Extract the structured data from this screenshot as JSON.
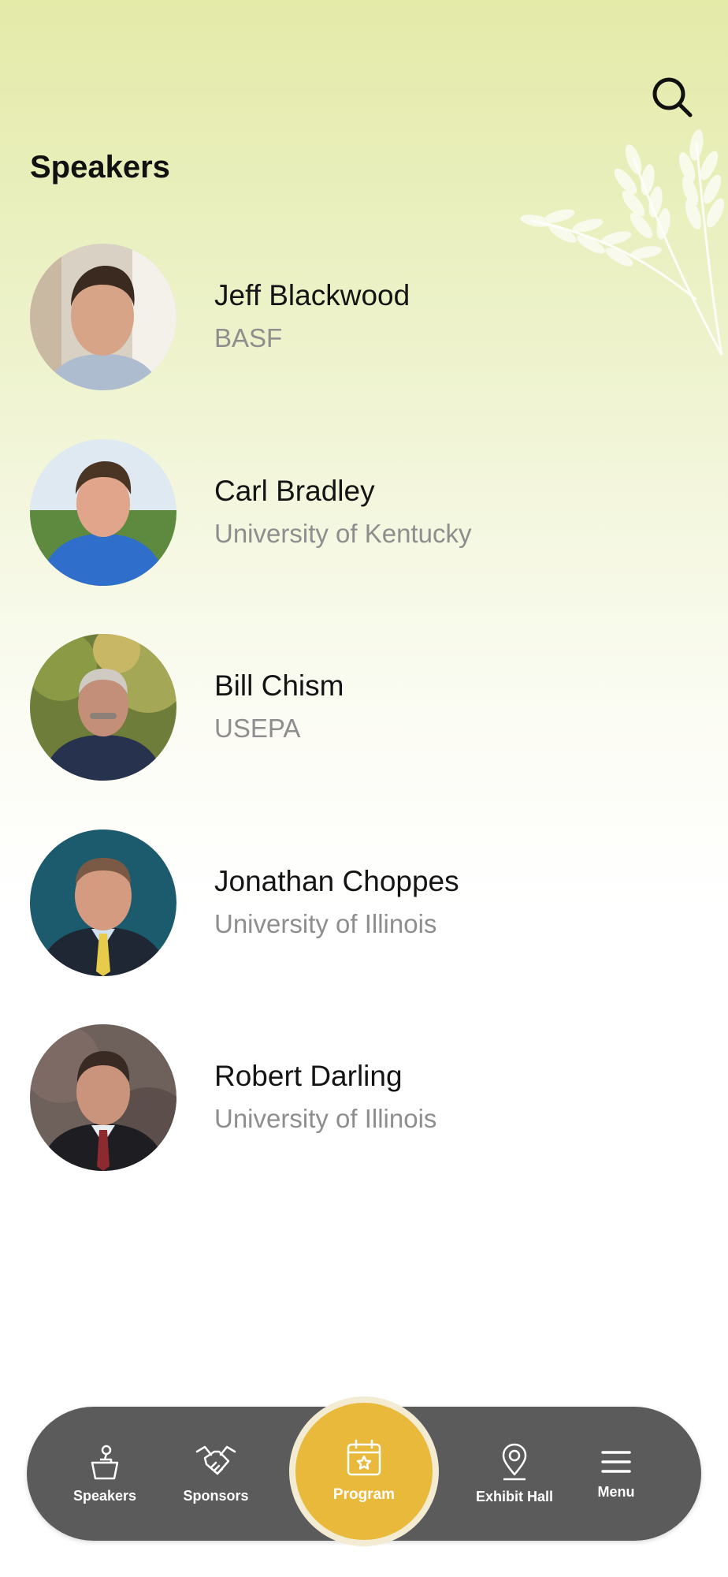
{
  "header": {
    "title": "Speakers",
    "search_icon": "search-icon"
  },
  "speakers": [
    {
      "name": "Jeff Blackwood",
      "organization": "BASF"
    },
    {
      "name": "Carl Bradley",
      "organization": "University of Kentucky"
    },
    {
      "name": "Bill Chism",
      "organization": "USEPA"
    },
    {
      "name": "Jonathan Choppes",
      "organization": "University of Illinois"
    },
    {
      "name": "Robert Darling",
      "organization": "University of Illinois"
    }
  ],
  "bottom_nav": {
    "items": [
      {
        "label": "Speakers",
        "icon": "podium-icon"
      },
      {
        "label": "Sponsors",
        "icon": "handshake-icon"
      },
      {
        "label": "Program",
        "icon": "calendar-star-icon"
      },
      {
        "label": "Exhibit Hall",
        "icon": "map-pin-icon"
      },
      {
        "label": "Menu",
        "icon": "hamburger-menu-icon"
      }
    ]
  },
  "colors": {
    "nav_background": "#5b5b5b",
    "program_accent": "#e9b93c",
    "header_gradient_top": "#e4eaa8",
    "secondary_text": "#8e8e8e"
  }
}
